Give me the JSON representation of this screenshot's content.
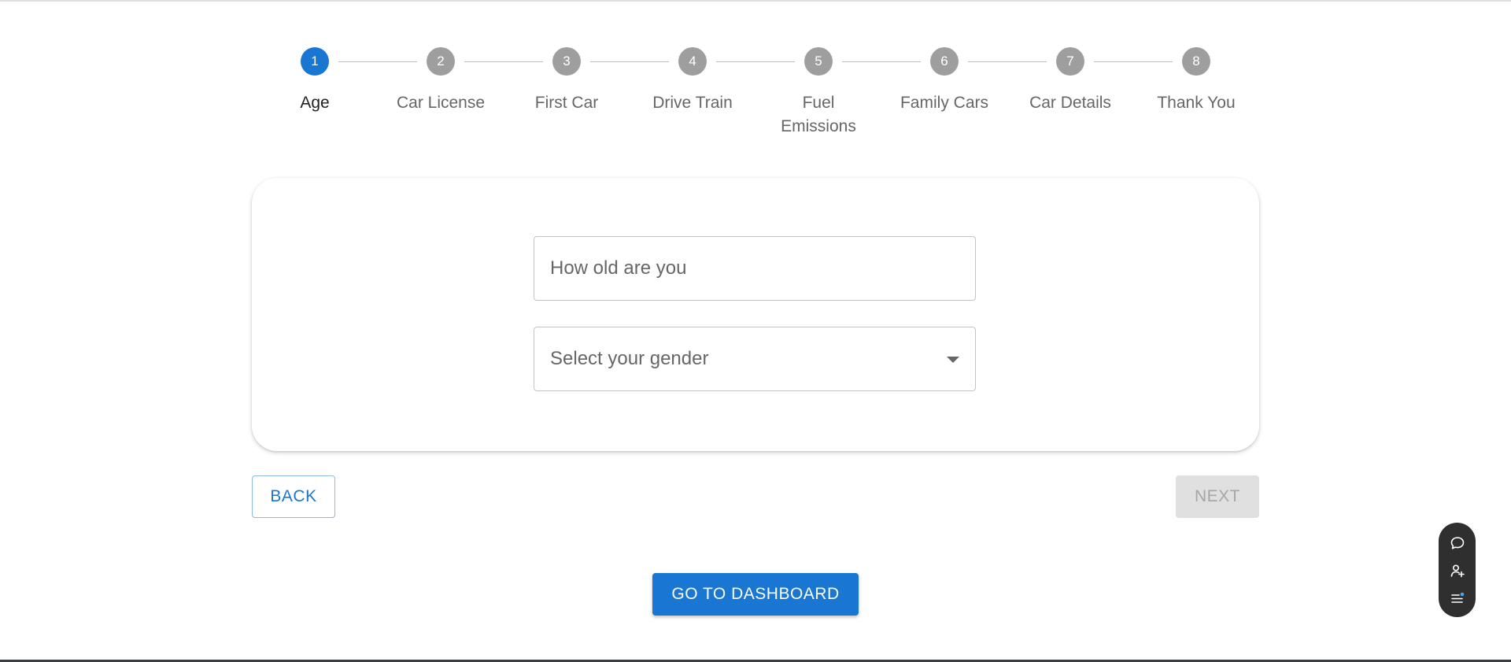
{
  "stepper": {
    "steps": [
      {
        "number": "1",
        "label": "Age",
        "active": true
      },
      {
        "number": "2",
        "label": "Car License",
        "active": false
      },
      {
        "number": "3",
        "label": "First Car",
        "active": false
      },
      {
        "number": "4",
        "label": "Drive Train",
        "active": false
      },
      {
        "number": "5",
        "label": "Fuel Emissions",
        "active": false
      },
      {
        "number": "6",
        "label": "Family Cars",
        "active": false
      },
      {
        "number": "7",
        "label": "Car Details",
        "active": false
      },
      {
        "number": "8",
        "label": "Thank You",
        "active": false
      }
    ],
    "active_color": "#1976d2",
    "inactive_color": "#9e9e9e"
  },
  "form": {
    "age_input": {
      "placeholder": "How old are you",
      "value": ""
    },
    "gender_select": {
      "placeholder": "Select your gender",
      "value": ""
    }
  },
  "navigation": {
    "back_label": "BACK",
    "next_label": "NEXT",
    "dashboard_label": "GO TO DASHBOARD"
  },
  "floating_toolbar": {
    "icons": [
      "chat-bubble-icon",
      "add-person-icon",
      "notes-list-icon"
    ],
    "indicator_color": "#42a5f5"
  }
}
